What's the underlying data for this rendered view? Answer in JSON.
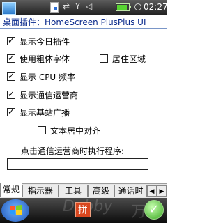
{
  "status_bar": {
    "time": "02:27",
    "icons": "⇄ Y ◁"
  },
  "title": "桌面插件：HomeScreen PlusPlus UI",
  "options": [
    {
      "label": "显示今日插件",
      "checked": true
    },
    {
      "label": "使用粗体字体",
      "checked": true
    },
    {
      "label": "居住区域",
      "checked": false
    },
    {
      "label": "显示 CPU 频率",
      "checked": true
    },
    {
      "label": "显示通信运营商",
      "checked": true
    },
    {
      "label": "显示基站广播",
      "checked": true
    },
    {
      "label": "文本居中对齐",
      "checked": false
    }
  ],
  "prompt_label": "点击通信运营商时执行程序:",
  "program_value": "",
  "tabs": [
    "常规",
    "指示器",
    "工具",
    "高级",
    "通话时"
  ],
  "taskbar": {
    "ime_label": "拼",
    "ok_label": "✓",
    "watermark_left": "Dobby",
    "watermark_right": "万"
  }
}
